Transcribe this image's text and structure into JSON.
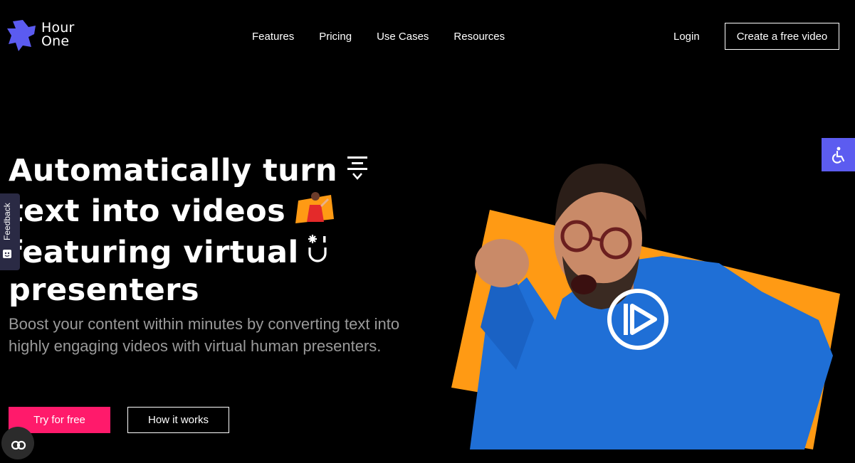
{
  "logo": {
    "line1": "Hour",
    "line2": "One"
  },
  "nav": {
    "items": [
      {
        "label": "Features"
      },
      {
        "label": "Pricing"
      },
      {
        "label": "Use Cases"
      },
      {
        "label": "Resources"
      }
    ],
    "login": "Login",
    "cta": "Create a free video"
  },
  "feedback": {
    "label": "Feedback"
  },
  "hero": {
    "line1": "Automatically turn",
    "line2": "text into videos",
    "line3": "featuring virtual",
    "line4": "presenters",
    "subtext": "Boost your content within minutes by converting text into highly engaging videos with virtual human presenters.",
    "primary_cta": "Try for free",
    "secondary_cta": "How it works"
  },
  "colors": {
    "brand_purple": "#5b5bf0",
    "cta_pink": "#ff1a6b",
    "accent_orange": "#ff9a14",
    "sweater_blue": "#1f6fd6"
  },
  "icons": [
    "hour-one-logo-icon",
    "accessibility-icon",
    "text-lines-icon",
    "presenter-thumbnail-icon",
    "sparkle-smile-icon",
    "play-icon",
    "chat-icon"
  ]
}
